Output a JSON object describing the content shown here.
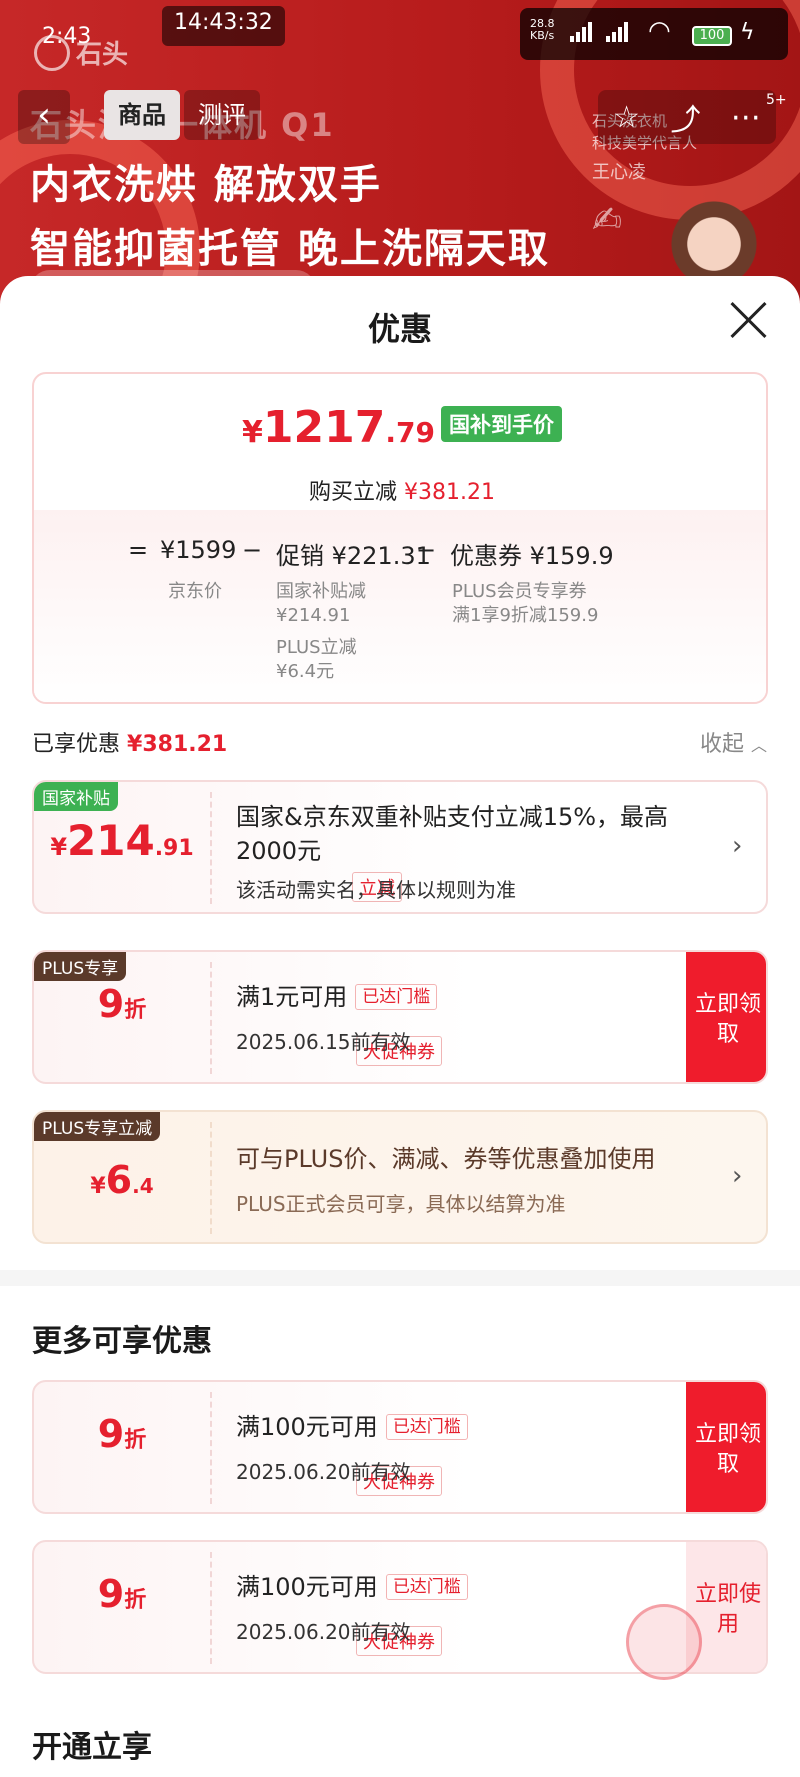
{
  "status_bar": {
    "time": "2:43",
    "clock": "14:43:32",
    "net_speed": "28.8",
    "net_unit": "KB/s",
    "battery": "100"
  },
  "background_page": {
    "brand": "石头",
    "tabs": [
      "商品",
      "测评"
    ],
    "active_tab": "商品",
    "badge_count": "5+",
    "hero_line1": "石头洗烘一体机 Q1",
    "hero_line2": "内衣洗烘 解放双手",
    "hero_line3": "智能抑菌托管 晚上洗隔天取",
    "spokesperson_title_1": "石头洗衣机",
    "spokesperson_title_2": "科技美学代言人",
    "spokesperson_name": "王心凌"
  },
  "sheet": {
    "title": "优惠",
    "summary": {
      "currency": "¥",
      "final_price_int": "1217",
      "final_price_dec": ".79",
      "price_tag": "国补到手价",
      "reduce_label": "购买立减",
      "reduce_amount": "¥381.21",
      "eq": "=",
      "jd_price": "¥1599",
      "minus": "−",
      "promo": "促销 ¥221.31",
      "coupon": "优惠券 ¥159.9",
      "jd_price_label": "京东价",
      "promo_sub1": "国家补贴减",
      "promo_sub1_val": "¥214.91",
      "promo_sub2": "PLUS立减",
      "promo_sub2_val": "¥6.4元",
      "coupon_sub1": "PLUS会员专享券",
      "coupon_sub2": "满1享9折减159.9"
    },
    "enjoyed_label": "已享优惠",
    "enjoyed_amount": "¥381.21",
    "collapse_label": "收起",
    "cards": [
      {
        "badge": "国家补贴",
        "amount_cur": "¥",
        "amount_int": "214",
        "amount_dec": ".91",
        "sub": "立减",
        "title": "国家&京东双重补贴支付立减15%，最高2000元",
        "note": "该活动需实名，具体以规则为准"
      },
      {
        "badge": "PLUS专享",
        "amount_int": "9",
        "amount_unit": "折",
        "sub": "大促神券",
        "title": "满1元可用",
        "met": "已达门槛",
        "note": "2025.06.15前有效",
        "button": "立即领取"
      },
      {
        "badge": "PLUS专享立减",
        "amount_cur": "¥",
        "amount_int": "6",
        "amount_dec": ".4",
        "title": "可与PLUS价、满减、券等优惠叠加使用",
        "note": "PLUS正式会员可享，具体以结算为准"
      }
    ],
    "more_title": "更多可享优惠",
    "more_cards": [
      {
        "amount_int": "9",
        "amount_unit": "折",
        "sub": "大促神券",
        "title": "满100元可用",
        "met": "已达门槛",
        "note": "2025.06.20前有效",
        "button": "立即领取"
      },
      {
        "amount_int": "9",
        "amount_unit": "折",
        "sub": "大促神券",
        "title": "满100元可用",
        "met": "已达门槛",
        "note": "2025.06.20前有效",
        "button": "立即使用"
      }
    ],
    "open_title": "开通立享"
  },
  "colors": {
    "accent_red": "#e5202e",
    "tag_green": "#3db152",
    "button_red": "#ef1c2c"
  }
}
